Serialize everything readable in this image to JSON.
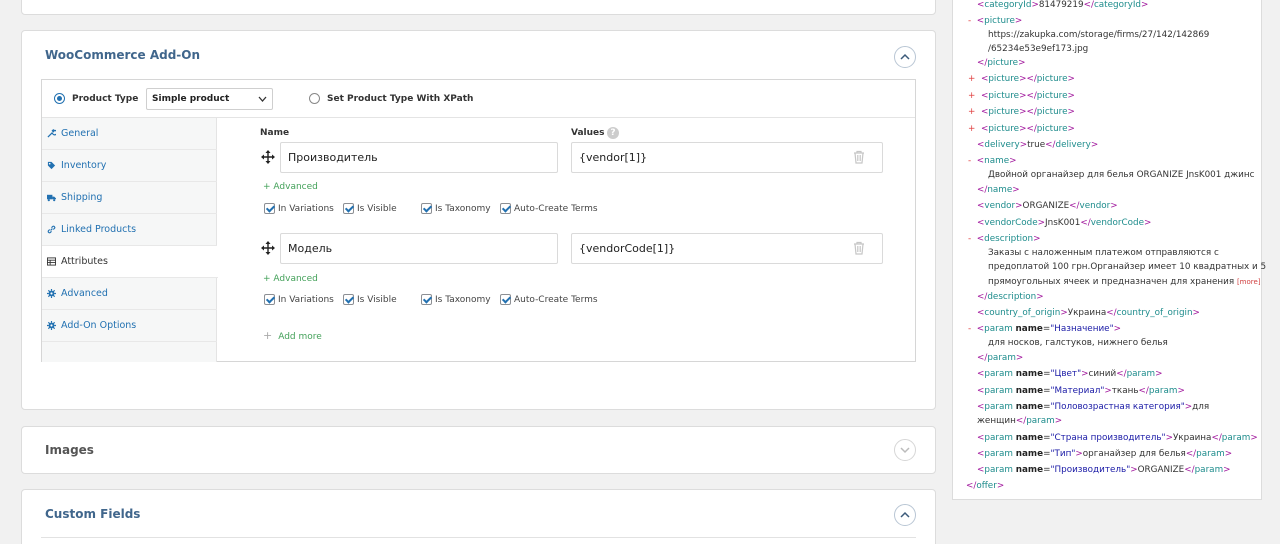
{
  "woocommerce": {
    "title": "WooCommerce Add-On",
    "product_type_label": "Product Type",
    "product_type_value": "Simple product",
    "xpath_label": "Set Product Type With XPath",
    "tabs": [
      {
        "label": "General",
        "icon": "wrench-icon"
      },
      {
        "label": "Inventory",
        "icon": "tag-icon"
      },
      {
        "label": "Shipping",
        "icon": "truck-icon"
      },
      {
        "label": "Linked Products",
        "icon": "link-icon"
      },
      {
        "label": "Attributes",
        "icon": "table-icon"
      },
      {
        "label": "Advanced",
        "icon": "gear-icon"
      },
      {
        "label": "Add-On Options",
        "icon": "gear-icon"
      }
    ],
    "name_header": "Name",
    "values_header": "Values",
    "help_icon": "?",
    "attributes": [
      {
        "name": "Производитель",
        "value": "{vendor[1]}"
      },
      {
        "name": "Модель",
        "value": "{vendorCode[1]}"
      }
    ],
    "advanced_link": "+ Advanced",
    "checkboxes": [
      "In Variations",
      "Is Visible",
      "Is Taxonomy",
      "Auto-Create Terms"
    ],
    "add_more_plus": "+",
    "add_more": "Add more"
  },
  "images": {
    "title": "Images"
  },
  "custom_fields": {
    "title": "Custom Fields"
  },
  "xml": {
    "category_id_line": {
      "tag": "categoryId",
      "text": "81479219"
    },
    "picture_open": "picture",
    "picture_url_1": "https://zakupka.com/storage/firms/27/142/142869",
    "picture_url_2": "/65234e53e9ef173.jpg",
    "picture_close": "picture",
    "empty_pictures": [
      "picture",
      "picture",
      "picture",
      "picture"
    ],
    "delivery": {
      "tag": "delivery",
      "text": "true"
    },
    "name_tag": "name",
    "name_text": "Двойной органайзер для белья ORGANIZE JnsK001 джинс",
    "vendor": {
      "tag": "vendor",
      "text": "ORGANIZE"
    },
    "vendor_code": {
      "tag": "vendorCode",
      "text": "JnsK001"
    },
    "description_tag": "description",
    "description_lines": [
      "Заказы с наложенным платежом отправляются с",
      "предоплатой 100 грн.Органайзер имеет 10 квадратных и 5",
      "прямоугольных ячеек и предназначен для хранения"
    ],
    "more_label": "[more]",
    "country": {
      "tag": "country_of_origin",
      "text": "Украина"
    },
    "param_tag": "param",
    "param_attr": "name",
    "param_naznachenie": {
      "name": "Назначение",
      "text": "для носков, галстуков, нижнего белья"
    },
    "params": [
      {
        "name": "Цвет",
        "text": "синий"
      },
      {
        "name": "Материал",
        "text": "ткань"
      }
    ],
    "param_pol": {
      "name": "Половозрастная категория",
      "text_1": "для",
      "text_2": "женщин"
    },
    "params2": [
      {
        "name": "Страна производитель",
        "text": "Украина"
      },
      {
        "name": "Тип",
        "text": "органайзер для белья"
      },
      {
        "name": "Производитель",
        "text": "ORGANIZE"
      }
    ],
    "offer_tag": "offer",
    "minus": "-",
    "plus": "+"
  }
}
